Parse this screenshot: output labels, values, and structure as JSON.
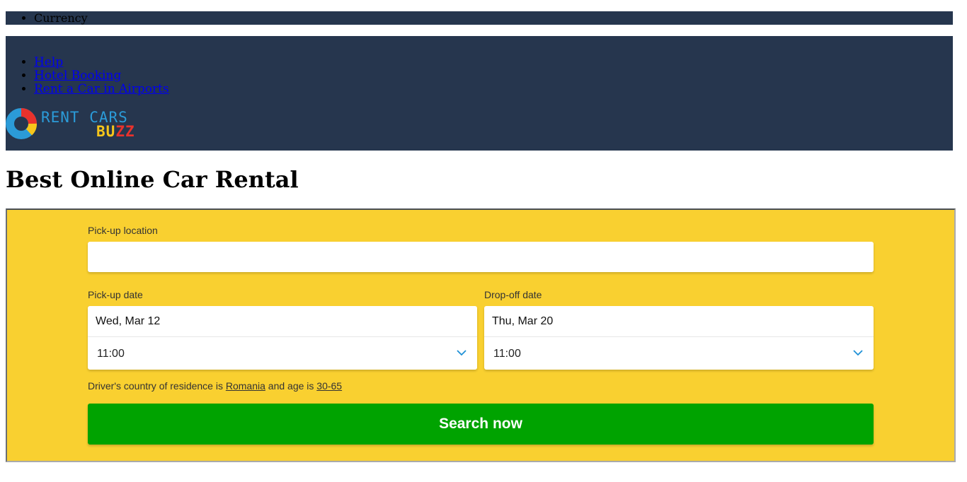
{
  "topbar": {
    "currency_label": "Currency"
  },
  "nav": {
    "items": [
      {
        "label": "Help"
      },
      {
        "label": "Hotel Booking"
      },
      {
        "label": "Rent a Car in Airports"
      }
    ]
  },
  "logo": {
    "line1": "RENT CARS",
    "line2_b": "B",
    "line2_u": "U",
    "line2_zz": "ZZ"
  },
  "page": {
    "title": "Best Online Car Rental"
  },
  "search": {
    "pickup_location_label": "Pick-up location",
    "pickup_location_value": "",
    "pickup_date_label": "Pick-up date",
    "pickup_date": "Wed, Mar 12",
    "pickup_time": "11:00",
    "dropoff_date_label": "Drop-off date",
    "dropoff_date": "Thu, Mar 20",
    "dropoff_time": "11:00",
    "driver_prefix": "Driver's country of residence is",
    "driver_country": "Romania",
    "driver_mid": "and age is",
    "driver_age": "30-65",
    "button_label": "Search now"
  },
  "colors": {
    "header_bg": "#26364e",
    "search_bg": "#f9d030",
    "button_bg": "#00a300",
    "accent_chevron": "#1e90d6"
  }
}
